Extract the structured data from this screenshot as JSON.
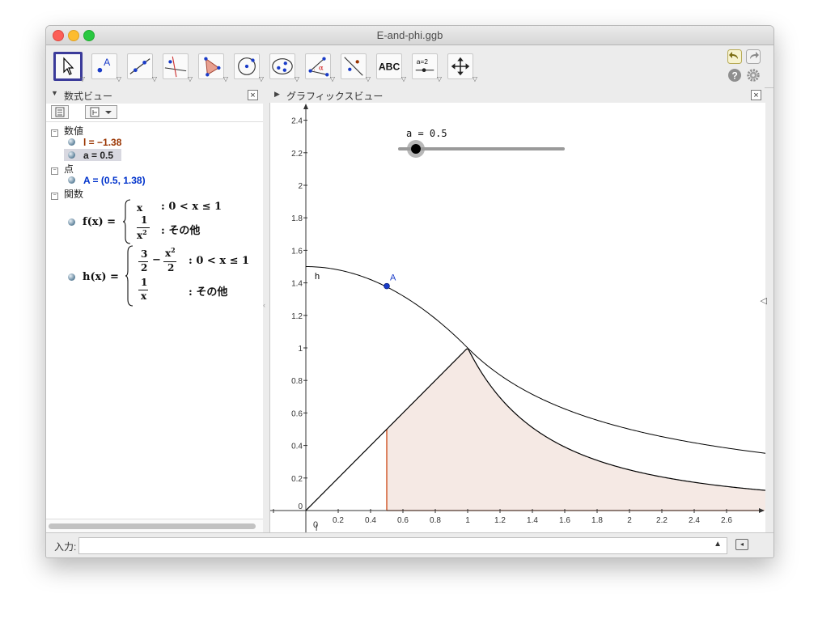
{
  "window": {
    "title": "E-and-phi.ggb"
  },
  "toolbar": {
    "tools": [
      "move",
      "point",
      "line",
      "perpendicular-line",
      "polygon",
      "circle",
      "conic",
      "angle",
      "reflect",
      "text",
      "slider",
      "move-graphics-view"
    ],
    "text_tool_label": "ABC",
    "slider_tool_label": "a=2"
  },
  "algebra_view": {
    "title": "数式ビュー",
    "categories": {
      "numbers": "数値",
      "points": "点",
      "functions": "関数"
    },
    "numbers": [
      {
        "text": "l = −1.38",
        "color": "#993300"
      },
      {
        "text": "a = 0.5",
        "color": "#111111"
      }
    ],
    "points": [
      {
        "text": "A = (0.5, 1.38)",
        "color": "#0033cc"
      }
    ],
    "functions": {
      "f": {
        "lhs": "f(x) =",
        "case1_expr": "x",
        "case1_cond": ": 0 < x ≤ 1",
        "case2_num": "1",
        "case2_den": "x",
        "case2_cond": ": その他"
      },
      "h": {
        "lhs": "h(x) =",
        "case1_frac_num": "3",
        "case1_frac_den": "2",
        "case1_minus": "−",
        "case1_x2_num": "x",
        "case1_x2_den": "2",
        "case1_cond": ": 0 < x ≤ 1",
        "case2_num": "1",
        "case2_den": "x",
        "case2_cond": ": その他"
      }
    }
  },
  "graphics_view": {
    "title": "グラフィックスビュー",
    "slider_label": "a = 0.5",
    "point_label": "A",
    "curve_label": "h",
    "lower_label": "l",
    "origin_label": "0"
  },
  "input_bar": {
    "label": "入力:"
  },
  "chart_data": {
    "type": "line",
    "x_ticks": [
      "0",
      "0.2",
      "0.4",
      "0.6",
      "0.8",
      "1",
      "1.2",
      "1.4",
      "1.6",
      "1.8",
      "2",
      "2.2",
      "2.4",
      "2.6"
    ],
    "y_ticks": [
      "0",
      "0.2",
      "0.4",
      "0.6",
      "0.8",
      "1",
      "1.2",
      "1.4",
      "1.6",
      "1.8",
      "2",
      "2.2",
      "2.4"
    ],
    "xlim": [
      -0.22,
      2.83
    ],
    "ylim": [
      -0.13,
      2.52
    ],
    "series": [
      {
        "name": "f",
        "color": "#000000",
        "definition": "x for 0<x≤1, 1/x² otherwise"
      },
      {
        "name": "h",
        "color": "#000000",
        "definition": "3/2 − x²/2 for 0<x≤1, 1/x otherwise"
      }
    ],
    "shaded_region": {
      "from_x": 0.5,
      "under": "f",
      "fill": "#f5e9e4",
      "edge_color": "#cc4411"
    },
    "point_A": {
      "x": 0.5,
      "y": 1.38,
      "color": "#1a3cc8"
    },
    "slider": {
      "name": "a",
      "value": 0.5
    }
  }
}
